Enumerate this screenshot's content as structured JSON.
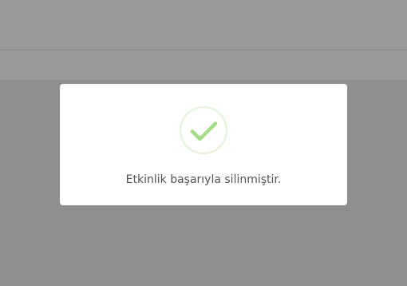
{
  "dialog": {
    "message": "Etkinlik başarıyla silinmiştir.",
    "icon": "success-checkmark-icon",
    "colors": {
      "icon_check": "#a5dc86",
      "icon_ring": "#e2f3d8"
    }
  }
}
